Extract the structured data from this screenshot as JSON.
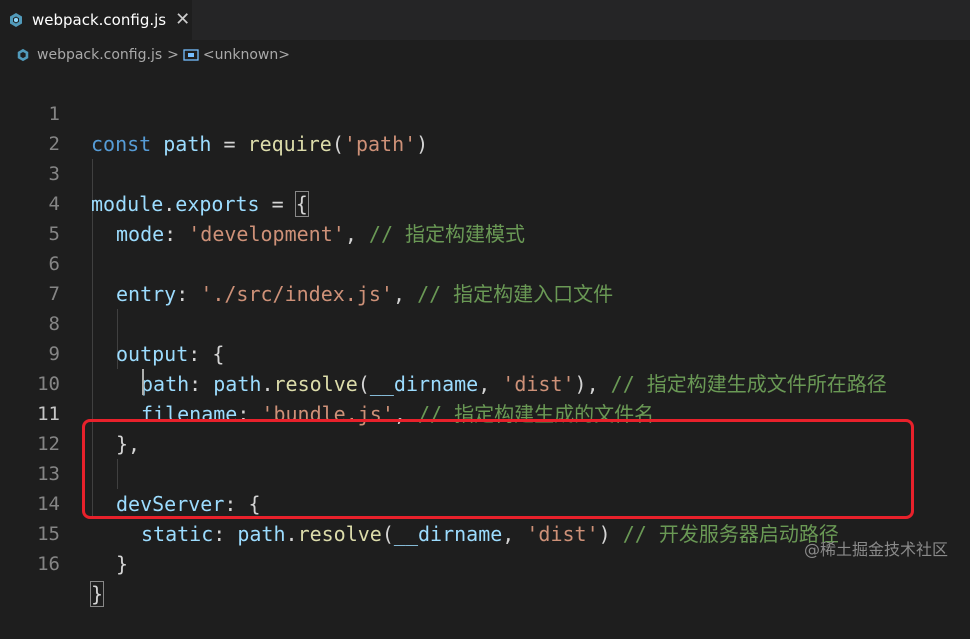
{
  "tab": {
    "label": "webpack.config.js",
    "close": "✕",
    "icon": "webpack-cube-icon",
    "icon_color": "#519aba"
  },
  "breadcrumb": {
    "file": "webpack.config.js",
    "separator": ">",
    "symbol": "<unknown>"
  },
  "editor": {
    "active_line": 11,
    "lines": [
      {
        "n": "1"
      },
      {
        "n": "2"
      },
      {
        "n": "3"
      },
      {
        "n": "4"
      },
      {
        "n": "5"
      },
      {
        "n": "6"
      },
      {
        "n": "7"
      },
      {
        "n": "8"
      },
      {
        "n": "9"
      },
      {
        "n": "10"
      },
      {
        "n": "11"
      },
      {
        "n": "12"
      },
      {
        "n": "13"
      },
      {
        "n": "14"
      },
      {
        "n": "15"
      },
      {
        "n": "16"
      }
    ],
    "tokens": {
      "l1": [
        "const",
        " ",
        "path",
        " = ",
        "require",
        "(",
        "'path'",
        ")"
      ],
      "l3": [
        "module",
        ".",
        "exports",
        " = ",
        "{"
      ],
      "l4": [
        "mode",
        ": ",
        "'development'",
        ", ",
        "// 指定构建模式"
      ],
      "l6": [
        "entry",
        ": ",
        "'./src/index.js'",
        ", ",
        "// 指定构建入口文件"
      ],
      "l8": [
        "output",
        ": {"
      ],
      "l9": [
        "path",
        ": ",
        "path",
        ".",
        "resolve",
        "(",
        "__dirname",
        ", ",
        "'dist'",
        "), ",
        "// 指定构建生成文件所在路径"
      ],
      "l10": [
        "filename",
        ": ",
        "'bundle.js'",
        ", ",
        "// 指定构建生成的文件名"
      ],
      "l11": [
        "},"
      ],
      "l13": [
        "devServer",
        ": {"
      ],
      "l14": [
        "static",
        ": ",
        "path",
        ".",
        "resolve",
        "(",
        "__dirname",
        ", ",
        "'dist'",
        ") ",
        "// 开发服务器启动路径"
      ],
      "l15": [
        "}"
      ],
      "l16": [
        "}"
      ]
    }
  },
  "watermark": "@稀土掘金技术社区",
  "colors": {
    "highlight_box": "#e8212b",
    "background": "#1e1e1e"
  }
}
